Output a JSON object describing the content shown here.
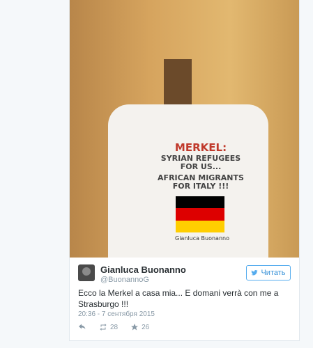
{
  "photo": {
    "shirt_line1": "MERKEL:",
    "shirt_line2": "SYRIAN REFUGEES FOR US...",
    "shirt_line3": "AFRICAN MIGRANTS FOR ITALY !!!",
    "shirt_signature": "Gianluca Buonanno",
    "flag_colors": [
      "#000000",
      "#dd0000",
      "#ffce00"
    ]
  },
  "tweet": {
    "author_name": "Gianluca Buonanno",
    "author_handle": "@BuonannoG",
    "follow_label": "Читать",
    "text": "Ecco la Merkel a casa mia... E domani verrà con me a Strasburgo !!!",
    "timestamp": "20:36 - 7 сентября 2015",
    "retweets": "28",
    "likes": "26"
  },
  "colors": {
    "accent": "#55acee",
    "muted": "#8899a6",
    "text": "#292f33"
  }
}
